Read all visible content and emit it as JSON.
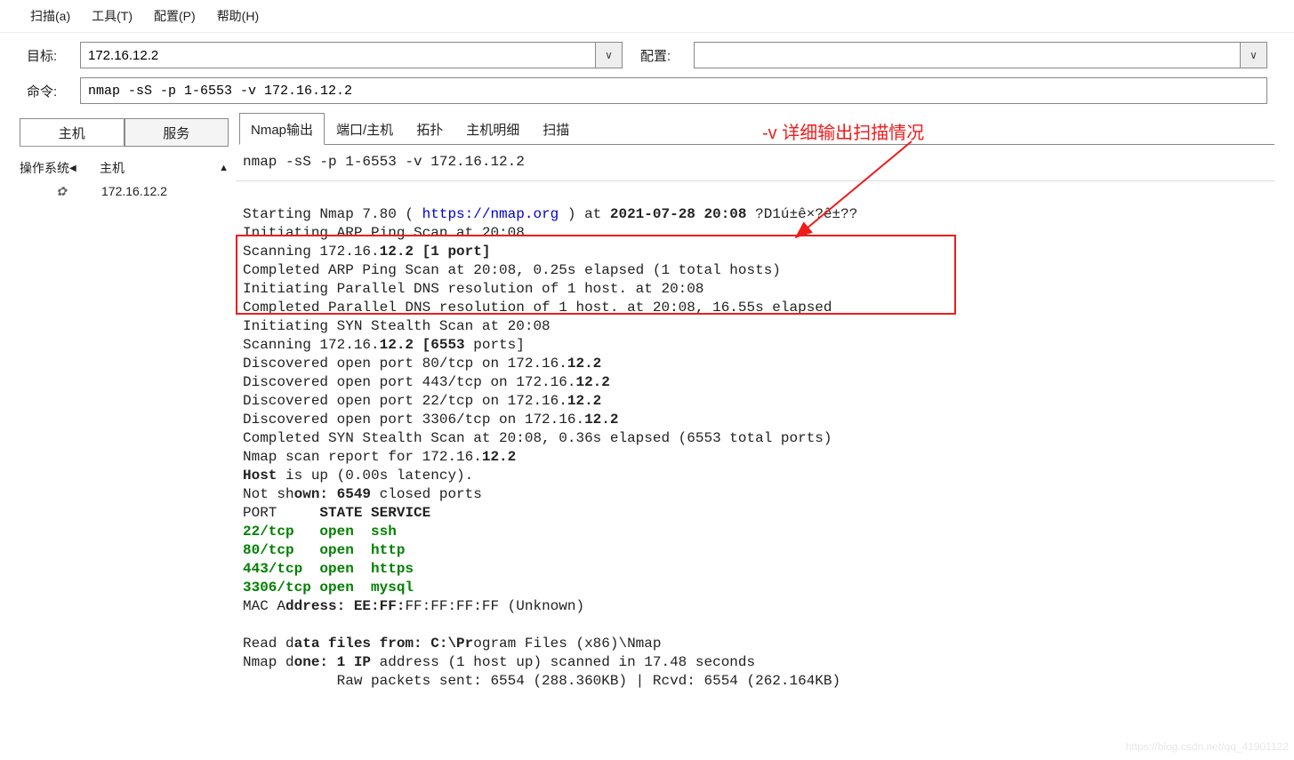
{
  "menu": {
    "scan": "扫描(a)",
    "tools": "工具(T)",
    "config": "配置(P)",
    "help": "帮助(H)"
  },
  "row1": {
    "target_label": "目标:",
    "target_value": "172.16.12.2",
    "config_label": "配置:",
    "config_value": ""
  },
  "row2": {
    "cmd_label": "命令:",
    "cmd_value": "nmap -sS -p 1-6553 -v 172.16.12.2"
  },
  "left": {
    "btn_host": "主机",
    "btn_service": "服务",
    "col_os": "操作系统",
    "col_host": "主机",
    "hosts": [
      {
        "ip": "172.16.12.2"
      }
    ]
  },
  "tabs": {
    "output": "Nmap输出",
    "ports": "端口/主机",
    "topology": "拓扑",
    "details": "主机明细",
    "scan": "扫描"
  },
  "cmd_echo": "nmap -sS -p 1-6553 -v 172.16.12.2",
  "annotation": "-v 详细输出扫描情况",
  "output": {
    "l1_a": "Starting Nmap 7.80 ( ",
    "l1_link": "https://nmap.org",
    "l1_b": " ) at ",
    "l1_date": "2021-07-28 20:08",
    "l1_c": " ?D1ú±ê×?ê±??",
    "l2": "Initiating ARP Ping Scan at 20:08",
    "l3_a": "Scanning 172.16.",
    "l3_bold": "12.2 [1 port]",
    "l4": "Completed ARP Ping Scan at 20:08, 0.25s elapsed (1 total hosts)",
    "l5": "Initiating Parallel DNS resolution of 1 host. at 20:08",
    "l6": "Completed Parallel DNS resolution of 1 host. at 20:08, 16.55s elapsed",
    "l7": "Initiating SYN Stealth Scan at 20:08",
    "l8_a": "Scanning 172.16.",
    "l8_b": "12.2 [6553 ",
    "l8_c": "ports]",
    "l9_a": "Discovered open port 80/tcp on 172.16.",
    "l9_b": "12.2",
    "l10_a": "Discovered open port 443/tcp on 172.16.",
    "l10_b": "12.2",
    "l11_a": "Discovered open port 22/tcp on 172.16.",
    "l11_b": "12.2",
    "l12_a": "Discovered open port 3306/tcp on 172.16.",
    "l12_b": "12.2",
    "l13": "Completed SYN Stealth Scan at 20:08, 0.36s elapsed (6553 total ports)",
    "l14_a": "Nmap scan report for 172.16.",
    "l14_b": "12.2",
    "l15_a": "Host",
    "l15_b": " is up (0.00s latency).",
    "l16_a": "Not sh",
    "l16_b": "own: 6549 ",
    "l16_c": "closed ports",
    "l17_a": "PORT     ",
    "l17_b": "STATE SERVICE",
    "p1": "22/tcp   open  ssh",
    "p2": "80/tcp   open  http",
    "p3": "443/tcp  open  https",
    "p4": "3306/tcp open  mysql",
    "mac_a": "MAC A",
    "mac_b": "ddress: EE:FF:",
    "mac_c": "FF:FF:FF:FF (Unknown)",
    "read_a": "Read d",
    "read_b": "ata files from: C:\\Pr",
    "read_c": "ogram Files (x86)\\Nmap",
    "done_a": "Nmap d",
    "done_b": "one: 1 IP ",
    "done_c": "address (1 host up) scanned in 17.48 seconds",
    "raw": "           Raw packets sent: 6554 (288.360KB) | Rcvd: 6554 (262.164KB)"
  },
  "watermark": "https://blog.csdn.net/qq_41901122"
}
